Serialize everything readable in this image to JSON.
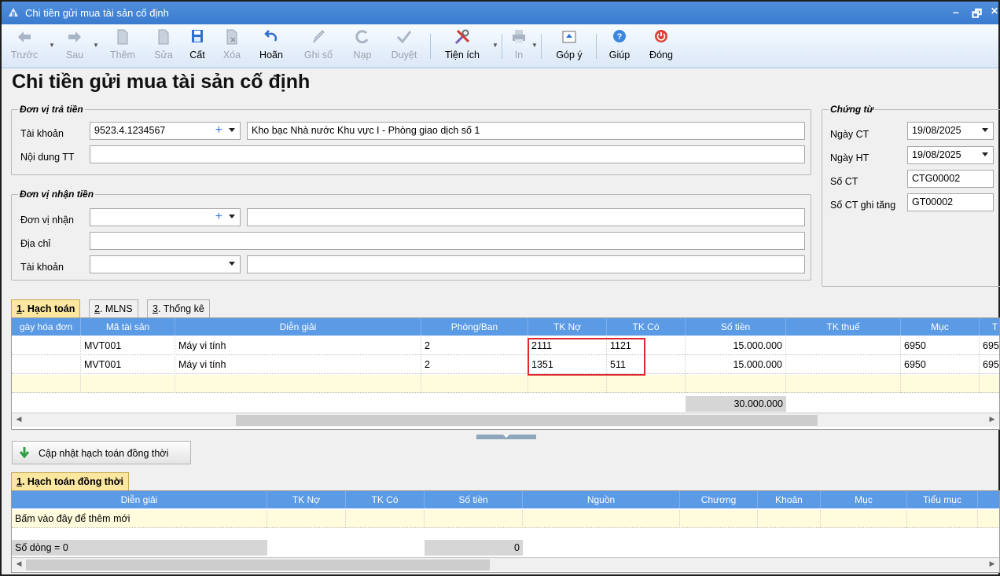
{
  "window": {
    "title": "Chi tiền gửi mua tài sản cố định",
    "restore_glyph": "🗗",
    "close_glyph": "✕",
    "min_glyph": "–"
  },
  "toolbar": {
    "truoc": "Trước",
    "sau": "Sau",
    "them": "Thêm",
    "sua": "Sửa",
    "cat": "Cất",
    "xoa": "Xóa",
    "hoan": "Hoãn",
    "ghiso": "Ghi sổ",
    "nap": "Nạp",
    "duyet": "Duyệt",
    "tienich": "Tiện ích",
    "in": "In",
    "gopy": "Góp ý",
    "giup": "Giúp",
    "dong": "Đóng"
  },
  "page_title": "Chi tiền gửi mua tài sản cố định",
  "payer": {
    "legend": "Đơn vị trả tiền",
    "account_label": "Tài khoản",
    "account_value": "9523.4.1234567",
    "account_name": "Kho bạc Nhà nước Khu vực I - Phòng giao dịch số 1",
    "content_label": "Nội dung TT",
    "content_value": ""
  },
  "payee": {
    "legend": "Đơn vị nhận tiền",
    "unit_label": "Đơn vị nhận",
    "address_label": "Địa chỉ",
    "account_label": "Tài khoản"
  },
  "voucher": {
    "legend": "Chứng từ",
    "ngay_ct_label": "Ngày CT",
    "ngay_ct": "19/08/2025",
    "ngay_ht_label": "Ngày HT",
    "ngay_ht": "19/08/2025",
    "so_ct_label": "Số CT",
    "so_ct": "CTG00002",
    "so_ct_ghi_tang_label": "Số CT ghi tăng",
    "so_ct_ghi_tang": "GT00002"
  },
  "tabs": [
    "1. Hạch toán",
    "2. MLNS",
    "3. Thống kê"
  ],
  "grid1": {
    "headers": [
      "gày hóa đơn",
      "Mã tài sản",
      "Diễn giải",
      "Phòng/Ban",
      "TK Nợ",
      "TK Có",
      "Số tiền",
      "TK thuế",
      "Mục",
      "T"
    ],
    "rows": [
      [
        "",
        "MVT001",
        "Máy vi tính",
        "2",
        "2111",
        "1121",
        "15.000.000",
        "",
        "6950",
        "695"
      ],
      [
        "",
        "MVT001",
        "Máy vi tính",
        "2",
        "1351",
        "511",
        "15.000.000",
        "",
        "6950",
        "695"
      ]
    ],
    "total": "30.000.000"
  },
  "update_button": "Cập nhật hạch toán đồng thời",
  "tab2": "1. Hạch toán đồng thời",
  "grid2": {
    "headers": [
      "Diễn giải",
      "TK Nợ",
      "TK Có",
      "Số tiền",
      "Nguồn",
      "Chương",
      "Khoản",
      "Mục",
      "Tiểu mục"
    ],
    "placeholder_row": "Bấm vào đây để thêm mới",
    "row_count": "Số dòng = 0",
    "total": "0"
  },
  "colors": {
    "header_blue": "#5b9ae5",
    "highlight_red": "#e0282c",
    "tab_active": "#fbe7a0"
  }
}
